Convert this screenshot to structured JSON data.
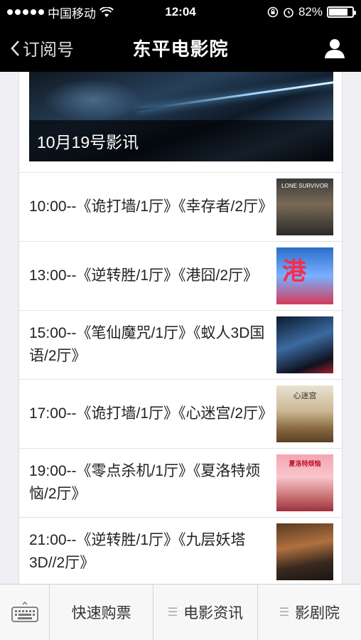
{
  "status": {
    "carrier": "中国移动",
    "time": "12:04",
    "battery": "82%",
    "battery_level": 0.82
  },
  "nav": {
    "back_label": "订阅号",
    "title": "东平电影院"
  },
  "banner": {
    "caption": "10月19号影讯"
  },
  "schedule": [
    {
      "text": "10:00--《诡打墙/1厅》《幸存者/2厅》",
      "poster": "LONE SURVIVOR"
    },
    {
      "text": "13:00--《逆转胜/1厅》《港囧/2厅》",
      "poster": "港"
    },
    {
      "text": "15:00--《笔仙魔咒/1厅》《蚁人3D国语/2厅》",
      "poster": ""
    },
    {
      "text": "17:00--《诡打墙/1厅》《心迷宫/2厅》",
      "poster": "心迷宫"
    },
    {
      "text": "19:00--《零点杀机/1厅》《夏洛特烦恼/2厅》",
      "poster": "夏洛特烦恼"
    },
    {
      "text": "21:00--《逆转胜/1厅》《九层妖塔3D//2厅》",
      "poster": ""
    }
  ],
  "tabs": {
    "t1": "快速购票",
    "t2": "电影资讯",
    "t3": "影剧院"
  },
  "colors": {
    "bar": "#000000",
    "tabbar": "#f7f7f8",
    "accent": "#ff2a4a"
  }
}
